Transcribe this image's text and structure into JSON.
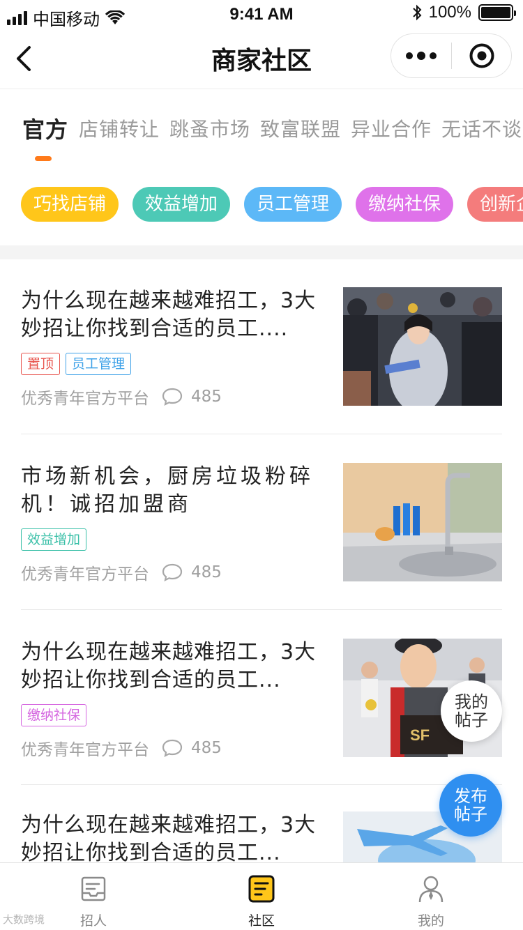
{
  "status_bar": {
    "carrier": "中国移动",
    "time": "9:41 AM",
    "battery": "100%"
  },
  "nav": {
    "title": "商家社区"
  },
  "tabs": [
    {
      "label": "官方",
      "active": true
    },
    {
      "label": "店铺转让",
      "active": false
    },
    {
      "label": "跳蚤市场",
      "active": false
    },
    {
      "label": "致富联盟",
      "active": false
    },
    {
      "label": "异业合作",
      "active": false
    },
    {
      "label": "无话不谈",
      "active": false
    }
  ],
  "chips": [
    {
      "label": "巧找店铺",
      "color": "#ffc61a"
    },
    {
      "label": "效益增加",
      "color": "#4dc9b6"
    },
    {
      "label": "员工管理",
      "color": "#5cb8f7"
    },
    {
      "label": "缴纳社保",
      "color": "#df72ea"
    },
    {
      "label": "创新企",
      "color": "#f47c7c"
    }
  ],
  "posts": [
    {
      "title": "为什么现在越来越难招工，3大妙招让你找到合适的员工....",
      "tags": [
        {
          "label": "置顶",
          "color": "#e8554e"
        },
        {
          "label": "员工管理",
          "color": "#3fa2e8"
        }
      ],
      "author": "优秀青年官方平台",
      "comments": "485",
      "thumb": "crowd-street-photo"
    },
    {
      "title": "市场新机会，厨房垃圾粉碎机！诚招加盟商",
      "tags": [
        {
          "label": "效益增加",
          "color": "#38bfa7"
        }
      ],
      "author": "优秀青年官方平台",
      "comments": "485",
      "thumb": "kitchen-sink-photo"
    },
    {
      "title": "为什么现在越来越难招工，3大妙招让你找到合适的员工...",
      "tags": [
        {
          "label": "缴纳社保",
          "color": "#d566e0"
        }
      ],
      "author": "优秀青年官方平台",
      "comments": "485",
      "thumb": "courier-photo"
    },
    {
      "title": "为什么现在越来越难招工，3大妙招让你找到合适的员工...",
      "tags": [],
      "author": "",
      "comments": "",
      "thumb": "airplane-photo"
    }
  ],
  "fabs": {
    "mine": "我的帖子",
    "publish": "发布帖子"
  },
  "tab_bar": [
    {
      "label": "招人",
      "icon": "recruit-icon",
      "active": false
    },
    {
      "label": "社区",
      "icon": "community-icon",
      "active": true
    },
    {
      "label": "我的",
      "icon": "profile-icon",
      "active": false
    }
  ],
  "watermark": "大数跨境",
  "colors": {
    "accent": "#ff7a1a",
    "active_tab_icon": "#ffc61a",
    "publish": "#2f8ff0"
  }
}
